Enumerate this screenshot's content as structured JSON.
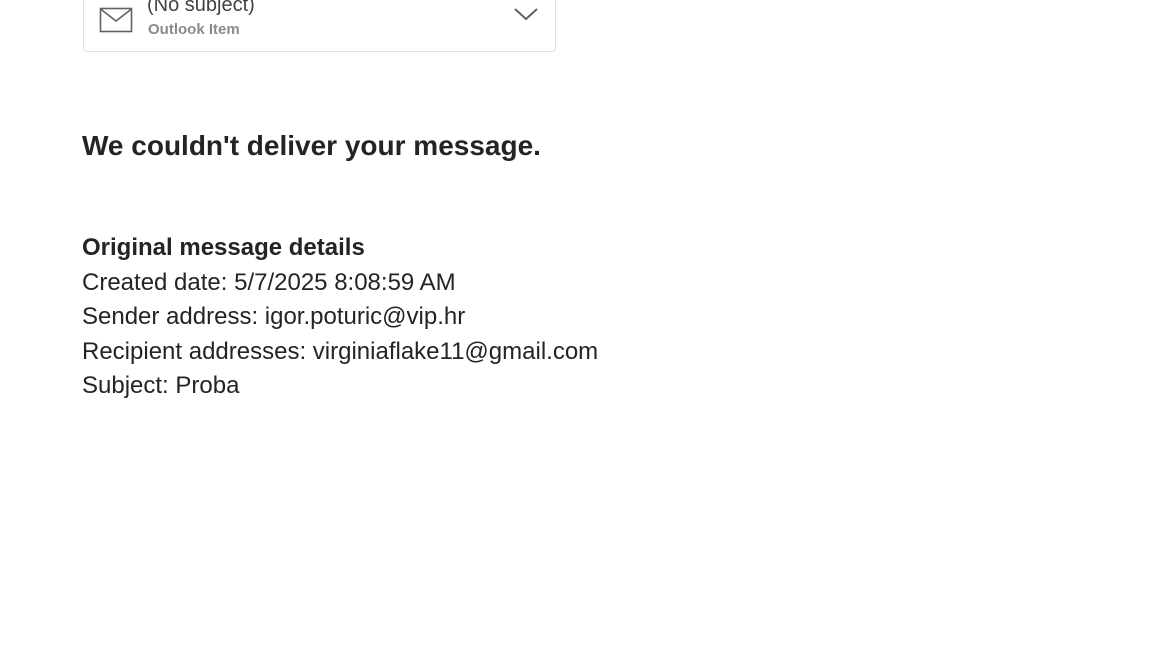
{
  "attachment": {
    "title": "(No subject)",
    "subtitle": "Outlook Item",
    "icon": "mail-icon",
    "expand_icon": "chevron-down-icon"
  },
  "message": {
    "title": "We couldn't deliver your message."
  },
  "details": {
    "heading": "Original message details",
    "created": "Created date: 5/7/2025 8:08:59 AM",
    "sender": "Sender address: igor.poturic@vip.hr",
    "recipients": "Recipient addresses: virginiaflake11@gmail.com",
    "subject": "Subject: Proba"
  }
}
